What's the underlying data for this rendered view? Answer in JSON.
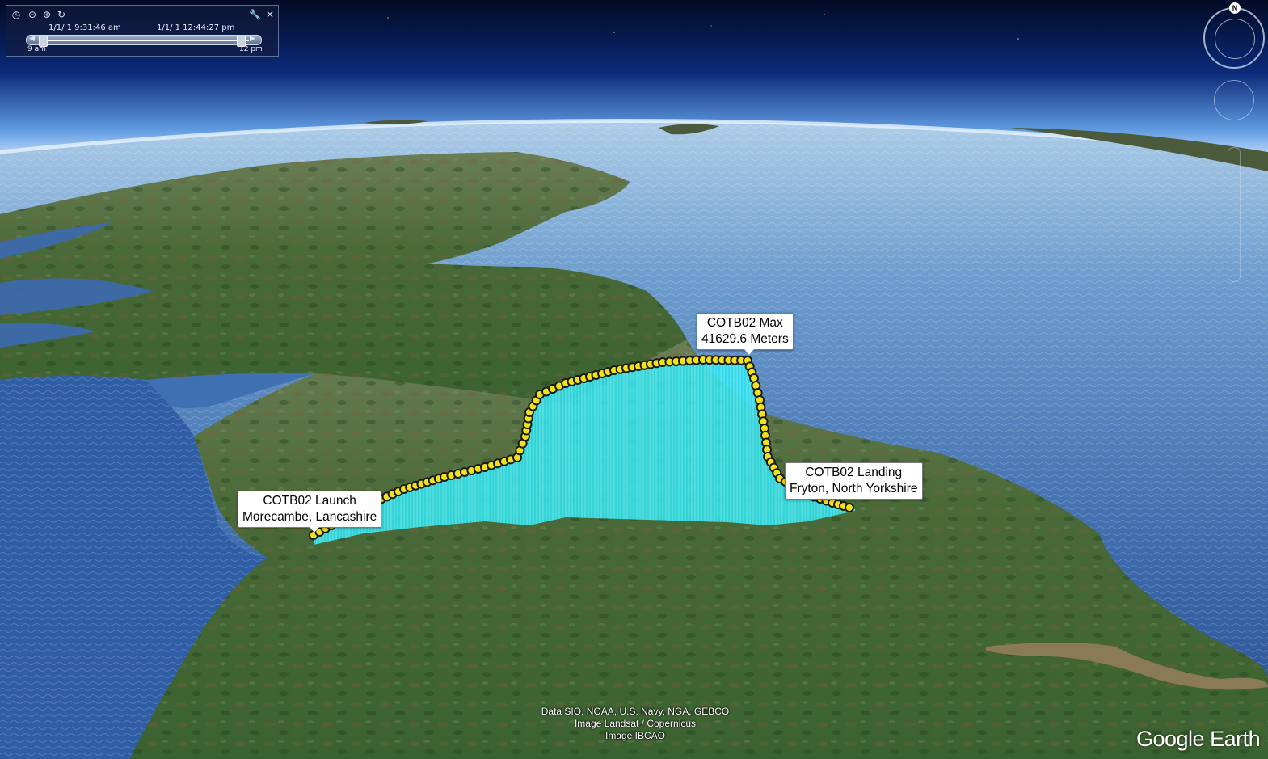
{
  "time_slider": {
    "start_time": "1/1/   1   9:31:46 am",
    "end_time": "1/1/   1  12:44:27 pm",
    "scale_start": "9 am",
    "scale_end": "12 pm",
    "icons": [
      "clock-icon",
      "zoom-out-icon",
      "zoom-in-icon",
      "refresh-icon",
      "settings-icon",
      "close-icon"
    ]
  },
  "navigation": {
    "north_label": "N"
  },
  "placemarks": {
    "launch": {
      "line1": "COTB02 Launch",
      "line2": "Morecambe, Lancashire"
    },
    "max": {
      "line1": "COTB02 Max",
      "line2": "41629.6 Meters"
    },
    "landing": {
      "line1": "COTB02 Landing",
      "line2": "Fryton, North Yorkshire"
    }
  },
  "attribution": {
    "line1": "Data SIO, NOAA, U.S. Navy, NGA, GEBCO",
    "line2": "Image Landsat / Copernicus",
    "line3": "Image IBCAO"
  },
  "logo": "Google Earth",
  "colors": {
    "track_fill": "#2ee6f2",
    "marker": "#f2e21a",
    "sea": "#2e5a9c",
    "land": "#3f6a33"
  }
}
